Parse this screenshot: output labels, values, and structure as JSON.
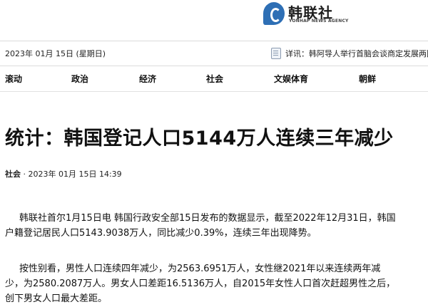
{
  "logo": {
    "name": "韩联社",
    "subtitle": "YONHAP NEWS AGENCY"
  },
  "topbar": {
    "date": "2023年 01月 15日 (星期日)",
    "ticker": "详讯：韩阿导人举行首脑会谈商定发展两国"
  },
  "nav": {
    "items": [
      "滚动",
      "政治",
      "经济",
      "社会",
      "文娱体育",
      "朝鲜"
    ],
    "active": "社会"
  },
  "article": {
    "title": "统计：韩国登记人口5144万人连续三年减少",
    "section": "社会",
    "datetime": "· 2023年 01月 15日 14:39",
    "paragraphs": [
      [
        "韩联社首尔1月15日电 韩国行政安全部15日发布的数据显示，截至2022年12月31日，韩国",
        "户籍登记居民人口5143.9038万人，同比减少0.39%，连续三年出现降势。"
      ],
      [
        "按性别看，男性人口连续四年减少，为2563.6951万人，女性继2021年以来连续两年减",
        "少，为2580.2087万人。男女人口差距16.5136万人，自2015年女性人口首次赶超男性之后，",
        "创下男女人口最大差距。"
      ]
    ]
  }
}
